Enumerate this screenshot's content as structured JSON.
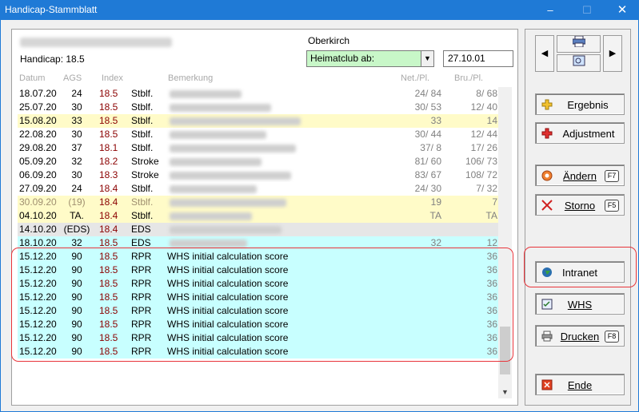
{
  "window": {
    "title": "Handicap-Stammblatt",
    "minimize": "–",
    "maximize": "☐",
    "close": "✕"
  },
  "header": {
    "handicap_label": "Handicap: 18.5",
    "club_name": "Oberkirch",
    "club_select_value": "Heimatclub ab:",
    "date_value": "27.10.01"
  },
  "columns": {
    "date": "Datum",
    "ags": "AGS",
    "index": "Index",
    "remark": "Bemerkung",
    "net": "Net./Pl.",
    "gross": "Bru./Pl."
  },
  "rows": [
    {
      "date": "18.07.20",
      "ags": "24",
      "index": "18.5",
      "type": "Stblf.",
      "remark": "",
      "net": "24/ 84",
      "gross": "8/ 68",
      "bg": "white",
      "blur": true
    },
    {
      "date": "25.07.20",
      "ags": "30",
      "index": "18.5",
      "type": "Stblf.",
      "remark": "",
      "net": "30/ 53",
      "gross": "12/ 40",
      "bg": "white",
      "blur": true
    },
    {
      "date": "15.08.20",
      "ags": "33",
      "index": "18.5",
      "type": "Stblf.",
      "remark": "",
      "net": "33",
      "gross": "14",
      "bg": "yellow",
      "blur": true
    },
    {
      "date": "22.08.20",
      "ags": "30",
      "index": "18.5",
      "type": "Stblf.",
      "remark": "",
      "net": "30/ 44",
      "gross": "12/ 44",
      "bg": "white",
      "blur": true
    },
    {
      "date": "29.08.20",
      "ags": "37",
      "index": "18.1",
      "type": "Stblf.",
      "remark": "",
      "net": "37/ 8",
      "gross": "17/ 26",
      "bg": "white",
      "blur": true
    },
    {
      "date": "05.09.20",
      "ags": "32",
      "index": "18.2",
      "type": "Stroke",
      "remark": "",
      "net": "81/ 60",
      "gross": "106/ 73",
      "bg": "white",
      "blur": true
    },
    {
      "date": "06.09.20",
      "ags": "30",
      "index": "18.3",
      "type": "Stroke",
      "remark": "",
      "net": "83/ 67",
      "gross": "108/ 72",
      "bg": "white",
      "blur": true
    },
    {
      "date": "27.09.20",
      "ags": "24",
      "index": "18.4",
      "type": "Stblf.",
      "remark": "",
      "net": "24/ 30",
      "gross": "7/ 32",
      "bg": "white",
      "blur": true
    },
    {
      "date": "30.09.20",
      "ags": "(19)",
      "index": "18.4",
      "type": "Stblf.",
      "remark": "",
      "net": "19",
      "gross": "7",
      "bg": "yellow",
      "blur": true,
      "dim": true
    },
    {
      "date": "04.10.20",
      "ags": "TA.",
      "index": "18.4",
      "type": "Stblf.",
      "remark": "",
      "net": "TA",
      "gross": "TA",
      "bg": "yellow",
      "blur": true
    },
    {
      "date": "14.10.20",
      "ags": "(EDS)",
      "index": "18.4",
      "type": "EDS",
      "remark": "",
      "net": "",
      "gross": "",
      "bg": "gray",
      "blur": true
    },
    {
      "date": "18.10.20",
      "ags": "32",
      "index": "18.5",
      "type": "EDS",
      "remark": "",
      "net": "32",
      "gross": "12",
      "bg": "cyan",
      "blur": true
    },
    {
      "date": "15.12.20",
      "ags": "90",
      "index": "18.5",
      "type": "RPR",
      "remark": "WHS initial calculation score",
      "net": "",
      "gross": "36",
      "bg": "cyan"
    },
    {
      "date": "15.12.20",
      "ags": "90",
      "index": "18.5",
      "type": "RPR",
      "remark": "WHS initial calculation score",
      "net": "",
      "gross": "36",
      "bg": "cyan"
    },
    {
      "date": "15.12.20",
      "ags": "90",
      "index": "18.5",
      "type": "RPR",
      "remark": "WHS initial calculation score",
      "net": "",
      "gross": "36",
      "bg": "cyan"
    },
    {
      "date": "15.12.20",
      "ags": "90",
      "index": "18.5",
      "type": "RPR",
      "remark": "WHS initial calculation score",
      "net": "",
      "gross": "36",
      "bg": "cyan"
    },
    {
      "date": "15.12.20",
      "ags": "90",
      "index": "18.5",
      "type": "RPR",
      "remark": "WHS initial calculation score",
      "net": "",
      "gross": "36",
      "bg": "cyan"
    },
    {
      "date": "15.12.20",
      "ags": "90",
      "index": "18.5",
      "type": "RPR",
      "remark": "WHS initial calculation score",
      "net": "",
      "gross": "36",
      "bg": "cyan"
    },
    {
      "date": "15.12.20",
      "ags": "90",
      "index": "18.5",
      "type": "RPR",
      "remark": "WHS initial calculation score",
      "net": "",
      "gross": "36",
      "bg": "cyan"
    },
    {
      "date": "15.12.20",
      "ags": "90",
      "index": "18.5",
      "type": "RPR",
      "remark": "WHS initial calculation score",
      "net": "",
      "gross": "36",
      "bg": "cyan"
    }
  ],
  "buttons": {
    "ergebnis": "Ergebnis",
    "adjustment": "Adjustment",
    "aendern": "Ändern",
    "aendern_key": "F7",
    "storno": "Storno",
    "storno_key": "F5",
    "intranet": "Intranet",
    "whs": "WHS",
    "drucken": "Drucken",
    "drucken_key": "F8",
    "ende": "Ende"
  },
  "colors": {
    "titlebar": "#1f7ad6",
    "highlight": "#e8343a",
    "index_red": "#8b0000"
  }
}
